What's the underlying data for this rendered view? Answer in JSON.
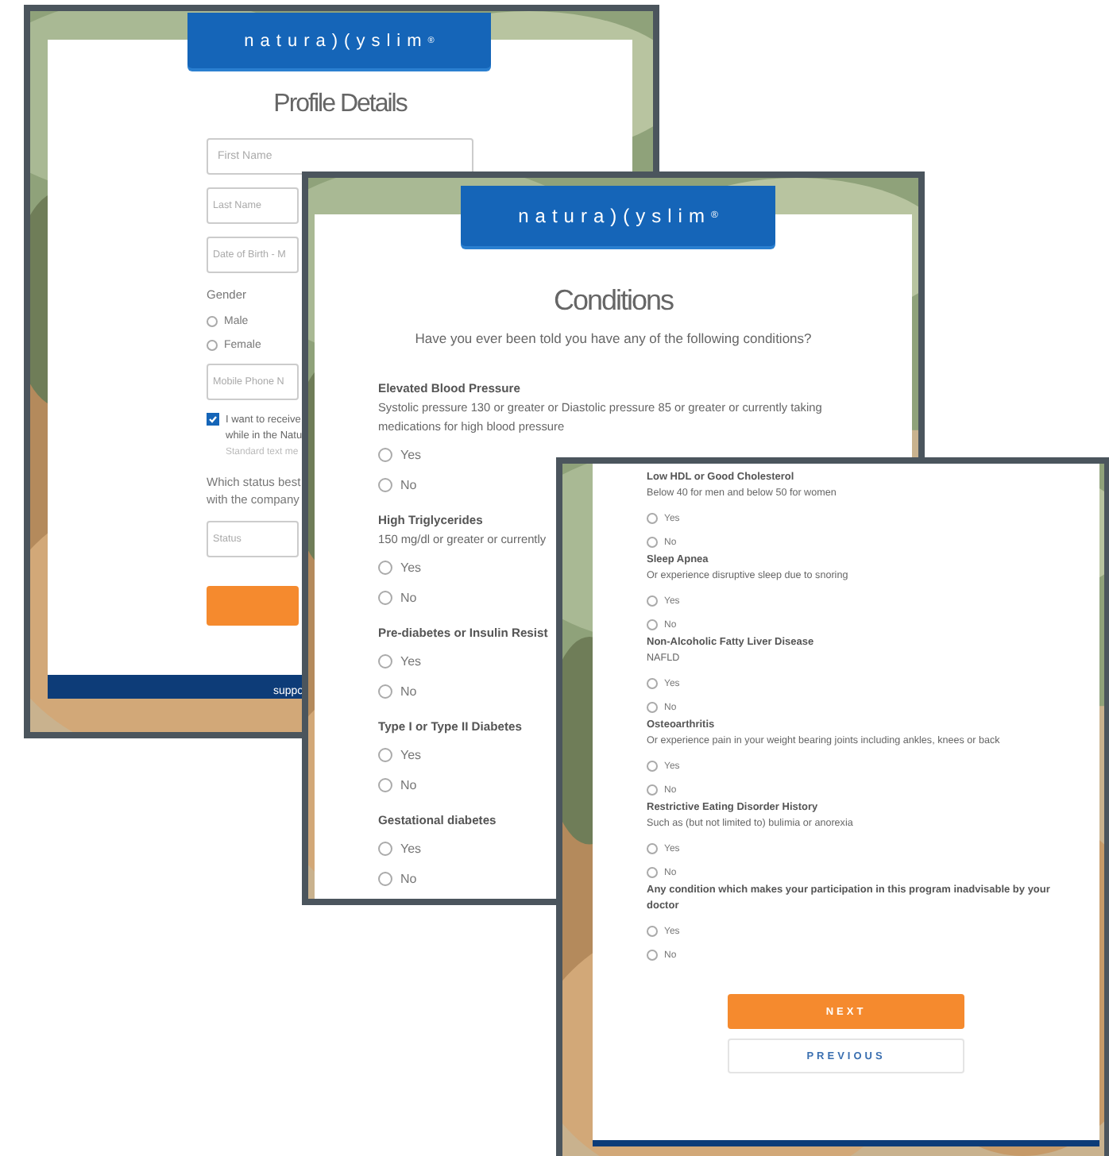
{
  "profile_window": {
    "logo": "natura)(yslim$^{®}$",
    "title": "Profile Details",
    "items": [
      {
        "kind": "field",
        "placeholder": "First Name"
      },
      {
        "kind": "field",
        "placeholder": "Last Name"
      },
      {
        "kind": "field",
        "placeholder": "Date of Birth - M"
      },
      {
        "kind": "label",
        "lines": [
          "Gender"
        ]
      },
      {
        "kind": "radio",
        "label": "Male",
        "selected": false
      },
      {
        "kind": "radio",
        "label": "Female",
        "selected": false
      },
      {
        "kind": "field",
        "placeholder": "Mobile Phone N"
      },
      {
        "kind": "checkbox",
        "lines": [
          "I want to receive",
          "while in the Natu"
        ],
        "note": "Standard text me",
        "checked": true
      },
      {
        "kind": "label",
        "lines": [
          "Which status best",
          "with the company"
        ]
      },
      {
        "kind": "field",
        "placeholder": "Status"
      },
      {
        "kind": "button"
      }
    ],
    "footer": "suppo"
  },
  "conditions_window": {
    "logo": "natura)(yslim$^{®}$",
    "title": "Conditions",
    "question": "Have you ever been told you have any of the following conditions?",
    "conditions": [
      {
        "title": "Elevated Blood Pressure",
        "description": [
          "Systolic pressure 130 or greater or Diastolic pressure 85 or greater or currently taking",
          "medications for high blood pressure"
        ],
        "options": [
          {
            "label": "Yes",
            "selected": false
          },
          {
            "label": "No",
            "selected": false
          }
        ]
      },
      {
        "title": "High Triglycerides",
        "description": [
          "150 mg/dl or greater or currently"
        ],
        "options": [
          {
            "label": "Yes",
            "selected": false
          },
          {
            "label": "No",
            "selected": false
          }
        ]
      },
      {
        "title": "Pre-diabetes or Insulin Resist",
        "options": [
          {
            "label": "Yes",
            "selected": false
          },
          {
            "label": "No",
            "selected": false
          }
        ]
      },
      {
        "title": "Type I or Type II Diabetes",
        "options": [
          {
            "label": "Yes",
            "selected": false
          },
          {
            "label": "No",
            "selected": false
          }
        ]
      },
      {
        "title": "Gestational diabetes",
        "options": [
          {
            "label": "Yes",
            "selected": false
          },
          {
            "label": "No",
            "selected": false
          }
        ]
      }
    ]
  },
  "conditions_window_scrolled": {
    "conditions": [
      {
        "title": "Low HDL or Good Cholesterol",
        "description": [
          "Below 40 for men and below 50 for women"
        ],
        "options": [
          {
            "label": "Yes",
            "selected": false
          },
          {
            "label": "No",
            "selected": false
          }
        ]
      },
      {
        "title": "Sleep Apnea",
        "description": [
          "Or experience disruptive sleep due to snoring"
        ],
        "options": [
          {
            "label": "Yes",
            "selected": false
          },
          {
            "label": "No",
            "selected": false
          }
        ]
      },
      {
        "title": "Non-Alcoholic Fatty Liver Disease",
        "description": [
          "NAFLD"
        ],
        "options": [
          {
            "label": "Yes",
            "selected": false
          },
          {
            "label": "No",
            "selected": false
          }
        ]
      },
      {
        "title": "Osteoarthritis",
        "description": [
          "Or experience pain in your weight bearing joints including ankles, knees or back"
        ],
        "options": [
          {
            "label": "Yes",
            "selected": false
          },
          {
            "label": "No",
            "selected": false
          }
        ]
      },
      {
        "title": "Restrictive Eating Disorder History",
        "description": [
          "Such as (but not limited to) bulimia or anorexia"
        ],
        "options": [
          {
            "label": "Yes",
            "selected": false
          },
          {
            "label": "No",
            "selected": false
          }
        ]
      },
      {
        "title": "Any condition which makes your participation in this program inadvisable by your doctor",
        "options": [
          {
            "label": "Yes",
            "selected": false
          },
          {
            "label": "No",
            "selected": false
          }
        ]
      }
    ],
    "buttons": [
      {
        "kind": "primary",
        "label": "NEXT"
      },
      {
        "kind": "secondary",
        "label": "PREVIOUS"
      }
    ]
  }
}
